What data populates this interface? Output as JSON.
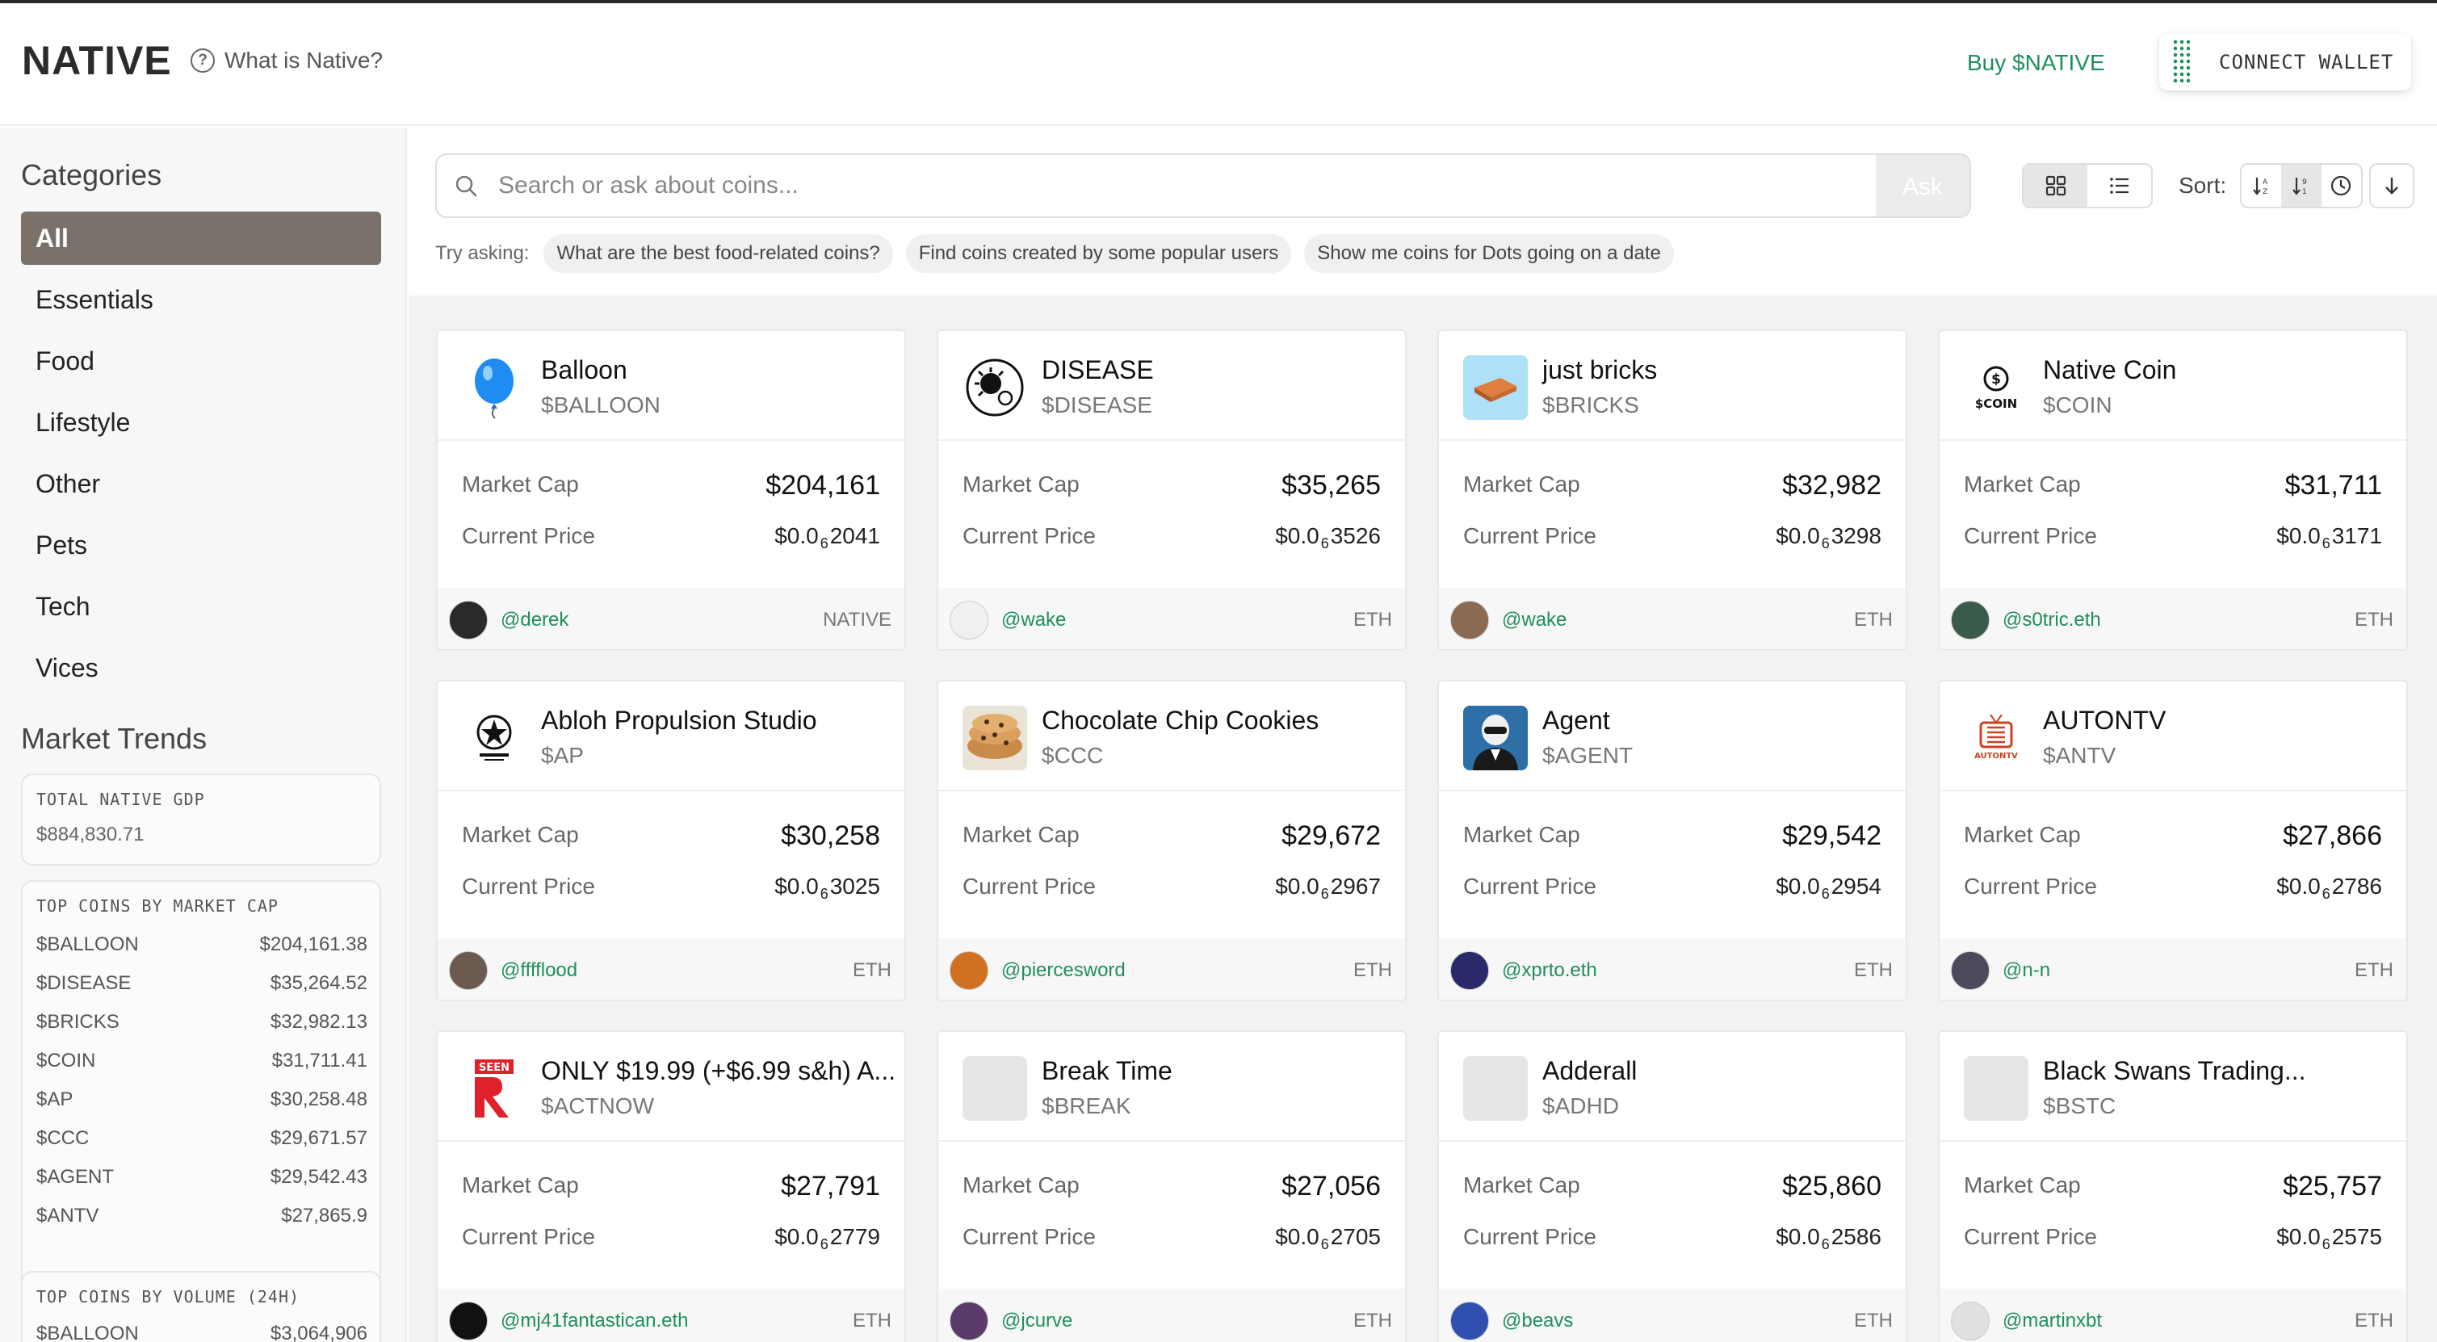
{
  "header": {
    "logo": "NATIVE",
    "what_is": "What is Native?",
    "buy_link": "Buy $NATIVE",
    "connect_wallet": "CONNECT WALLET"
  },
  "sidebar": {
    "categories_title": "Categories",
    "categories": [
      "All",
      "Essentials",
      "Food",
      "Lifestyle",
      "Other",
      "Pets",
      "Tech",
      "Vices"
    ],
    "active_category": "All",
    "market_trends_title": "Market Trends",
    "gdp": {
      "title": "TOTAL NATIVE GDP",
      "value": "$884,830.71"
    },
    "top_market_cap": {
      "title": "TOP COINS BY MARKET CAP",
      "rows": [
        {
          "ticker": "$BALLOON",
          "value": "$204,161.38"
        },
        {
          "ticker": "$DISEASE",
          "value": "$35,264.52"
        },
        {
          "ticker": "$BRICKS",
          "value": "$32,982.13"
        },
        {
          "ticker": "$COIN",
          "value": "$31,711.41"
        },
        {
          "ticker": "$AP",
          "value": "$30,258.48"
        },
        {
          "ticker": "$CCC",
          "value": "$29,671.57"
        },
        {
          "ticker": "$AGENT",
          "value": "$29,542.43"
        },
        {
          "ticker": "$ANTV",
          "value": "$27,865.9"
        }
      ]
    },
    "top_volume": {
      "title": "TOP COINS BY VOLUME (24H)",
      "rows": [
        {
          "ticker": "$BALLOON",
          "value": "$3,064,906"
        }
      ]
    }
  },
  "search": {
    "placeholder": "Search or ask about coins...",
    "ask_label": "Ask",
    "try_label": "Try asking:",
    "suggestions": [
      "What are the best food-related coins?",
      "Find coins created by some popular users",
      "Show me coins for Dots going on a date"
    ],
    "sort_label": "Sort:"
  },
  "labels": {
    "market_cap": "Market Cap",
    "current_price": "Current Price"
  },
  "coins": [
    {
      "name": "Balloon",
      "ticker": "$BALLOON",
      "market_cap": "$204,161",
      "price_prefix": "$0.0",
      "price_zeros": "6",
      "price_digits": "2041",
      "creator": "@derek",
      "chain": "NATIVE",
      "icon": "balloon-icon"
    },
    {
      "name": "DISEASE",
      "ticker": "$DISEASE",
      "market_cap": "$35,265",
      "price_prefix": "$0.0",
      "price_zeros": "6",
      "price_digits": "3526",
      "creator": "@wake",
      "chain": "ETH",
      "icon": "virus-icon"
    },
    {
      "name": "just bricks",
      "ticker": "$BRICKS",
      "market_cap": "$32,982",
      "price_prefix": "$0.0",
      "price_zeros": "6",
      "price_digits": "3298",
      "creator": "@wake",
      "chain": "ETH",
      "icon": "brick-icon"
    },
    {
      "name": "Native Coin",
      "ticker": "$COIN",
      "market_cap": "$31,711",
      "price_prefix": "$0.0",
      "price_zeros": "6",
      "price_digits": "3171",
      "creator": "@s0tric.eth",
      "chain": "ETH",
      "icon": "dollar-coin-icon",
      "icon_text": "$COIN"
    },
    {
      "name": "Abloh Propulsion Studio",
      "ticker": "$AP",
      "market_cap": "$30,258",
      "price_prefix": "$0.0",
      "price_zeros": "6",
      "price_digits": "3025",
      "creator": "@fffflood",
      "chain": "ETH",
      "icon": "ap-logo-icon"
    },
    {
      "name": "Chocolate Chip Cookies",
      "ticker": "$CCC",
      "market_cap": "$29,672",
      "price_prefix": "$0.0",
      "price_zeros": "6",
      "price_digits": "2967",
      "creator": "@piercesword",
      "chain": "ETH",
      "icon": "cookie-icon"
    },
    {
      "name": "Agent",
      "ticker": "$AGENT",
      "market_cap": "$29,542",
      "price_prefix": "$0.0",
      "price_zeros": "6",
      "price_digits": "2954",
      "creator": "@xprto.eth",
      "chain": "ETH",
      "icon": "agent-icon"
    },
    {
      "name": "AUTONTV",
      "ticker": "$ANTV",
      "market_cap": "$27,866",
      "price_prefix": "$0.0",
      "price_zeros": "6",
      "price_digits": "2786",
      "creator": "@n-n",
      "chain": "ETH",
      "icon": "autontv-logo-icon",
      "icon_text": "AUTONTV"
    },
    {
      "name": "ONLY $19.99 (+$6.99 s&h) A...",
      "ticker": "$ACTNOW",
      "market_cap": "$27,791",
      "price_prefix": "$0.0",
      "price_zeros": "6",
      "price_digits": "2779",
      "creator": "@mj41fantastican.eth",
      "chain": "ETH",
      "icon": "seen-tv-icon",
      "icon_text": "SEEN"
    },
    {
      "name": "Break Time",
      "ticker": "$BREAK",
      "market_cap": "$27,056",
      "price_prefix": "$0.0",
      "price_zeros": "6",
      "price_digits": "2705",
      "creator": "@jcurve",
      "chain": "ETH",
      "icon": "placeholder-icon"
    },
    {
      "name": "Adderall",
      "ticker": "$ADHD",
      "market_cap": "$25,860",
      "price_prefix": "$0.0",
      "price_zeros": "6",
      "price_digits": "2586",
      "creator": "@beavs",
      "chain": "ETH",
      "icon": "placeholder-icon"
    },
    {
      "name": "Black Swans Trading...",
      "ticker": "$BSTC",
      "market_cap": "$25,757",
      "price_prefix": "$0.0",
      "price_zeros": "6",
      "price_digits": "2575",
      "creator": "@martinxbt",
      "chain": "ETH",
      "icon": "placeholder-icon"
    }
  ],
  "colors": {
    "accent_green": "#1f8f5c",
    "active_category": "#7a726a"
  }
}
